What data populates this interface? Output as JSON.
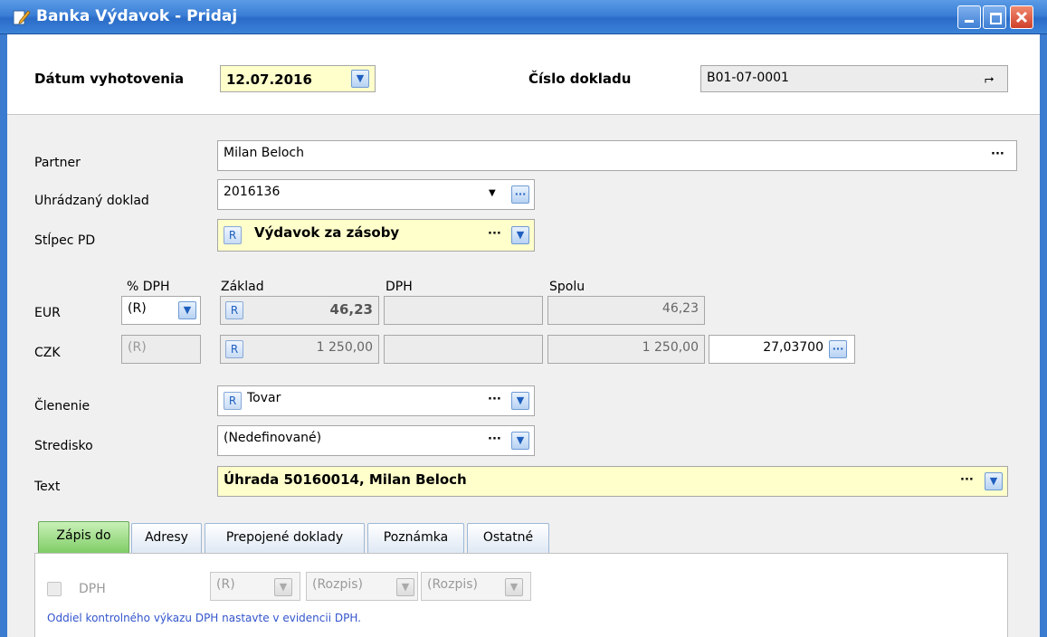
{
  "window": {
    "title": "Banka Výdavok - Pridaj"
  },
  "header": {
    "date_label": "Dátum vyhotovenia",
    "date_value": "12.07.2016",
    "doc_number_label": "Číslo dokladu",
    "doc_number_value": "B01-07-0001"
  },
  "form": {
    "partner_label": "Partner",
    "partner_value": "Milan Beloch",
    "paid_doc_label": "Uhrádzaný doklad",
    "paid_doc_value": "2016136",
    "column_label": "Stĺpec PD",
    "column_value": "Výdavok za zásoby",
    "column_badge": "R",
    "vat_pct_header": "% DPH",
    "base_header": "Základ",
    "vat_header": "DPH",
    "total_header": "Spolu",
    "eur_label": "EUR",
    "eur_vat_pct": "(R)",
    "eur_base": "46,23",
    "eur_vat": "",
    "eur_total": "46,23",
    "czk_label": "CZK",
    "czk_vat_pct": "(R)",
    "czk_base": "1 250,00",
    "czk_vat": "",
    "czk_total": "1 250,00",
    "czk_rate": "27,03700",
    "amount_badge": "R",
    "division_label": "Členenie",
    "division_value": "Tovar",
    "division_badge": "R",
    "center_label": "Stredisko",
    "center_value": "(Nedefinované)",
    "text_label": "Text",
    "text_value": "Úhrada 50160014, Milan Beloch"
  },
  "tabs": [
    {
      "label": "Zápis do",
      "active": true
    },
    {
      "label": "Adresy",
      "active": false
    },
    {
      "label": "Prepojené doklady",
      "active": false
    },
    {
      "label": "Poznámka",
      "active": false
    },
    {
      "label": "Ostatné",
      "active": false
    }
  ],
  "tab_panel": {
    "vat_checkbox_label": "DPH",
    "vat_checked": false,
    "select1": "(R)",
    "select2": "(Rozpis)",
    "select3": "(Rozpis)",
    "note": "Oddiel kontrolného výkazu DPH nastavte v evidencii DPH."
  },
  "colors": {
    "titlebar": "#3b7fd6",
    "highlight_field": "#ffffcc",
    "active_tab": "#7dcc63",
    "note_text": "#3355cc"
  }
}
